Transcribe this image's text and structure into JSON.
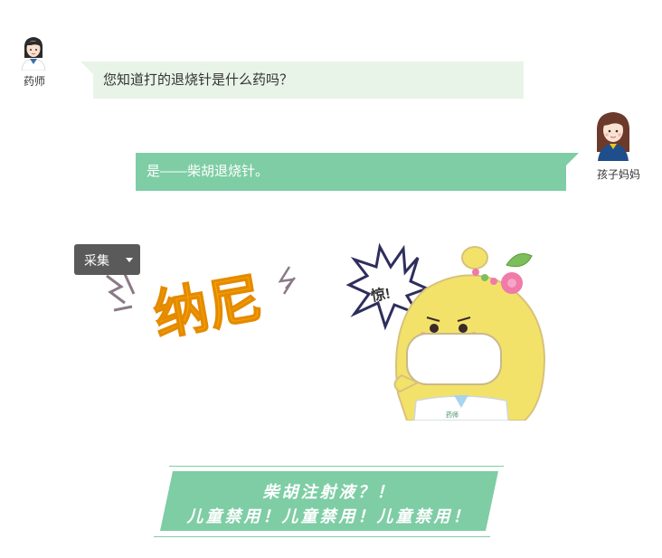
{
  "chat": {
    "pharmacist": {
      "name": "药师",
      "message": "您知道打的退烧针是什么药吗？"
    },
    "mother": {
      "name": "孩子妈妈",
      "message": "是——柴胡退烧针。"
    }
  },
  "toolbar": {
    "collect_label": "采集"
  },
  "sticker": {
    "main_text": "纳尼",
    "bubble_text": "惊!",
    "badge_text": "药师"
  },
  "banner": {
    "line1": "柴胡注射液？！",
    "line2": "儿童禁用！儿童禁用！儿童禁用！"
  },
  "colors": {
    "green": "#7ecda5",
    "light_green": "#e9f4e8",
    "button_gray": "#5a5a5a",
    "sticker_yellow": "#f5a800"
  }
}
